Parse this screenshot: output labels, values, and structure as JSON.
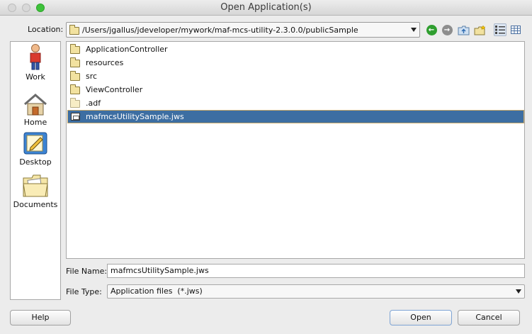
{
  "window": {
    "title": "Open Application(s)"
  },
  "location": {
    "label": "Location:",
    "path": "/Users/jgallus/jdeveloper/mywork/maf-mcs-utility-2.3.0.0/publicSample"
  },
  "toolbar": {
    "back_icon": "green-back-arrow",
    "forward_icon": "gray-forward-arrow",
    "up_folder_icon": "folder-up-icon",
    "new_folder_icon": "new-folder-icon",
    "list_view_icon": "list-view-icon",
    "details_view_icon": "details-view-icon"
  },
  "sidebar": {
    "items": [
      {
        "label": "Work",
        "icon": "person-icon"
      },
      {
        "label": "Home",
        "icon": "house-icon"
      },
      {
        "label": "Desktop",
        "icon": "desktop-icon"
      },
      {
        "label": "Documents",
        "icon": "documents-folder-icon"
      }
    ]
  },
  "files": [
    {
      "name": "ApplicationController",
      "type": "folder"
    },
    {
      "name": "resources",
      "type": "folder"
    },
    {
      "name": "src",
      "type": "folder"
    },
    {
      "name": "ViewController",
      "type": "folder"
    },
    {
      "name": ".adf",
      "type": "folder"
    },
    {
      "name": "mafmcsUtilitySample.jws",
      "type": "workspace",
      "selected": true
    }
  ],
  "file_name": {
    "label": "File Name:",
    "value": "mafmcsUtilitySample.jws"
  },
  "file_type": {
    "label": "File Type:",
    "value": "Application files  (*.jws)"
  },
  "buttons": {
    "help": "Help",
    "open": "Open",
    "cancel": "Cancel"
  },
  "colors": {
    "selection": "#3d6ea2",
    "background": "#ececec",
    "folder": "#f2e2a0"
  }
}
